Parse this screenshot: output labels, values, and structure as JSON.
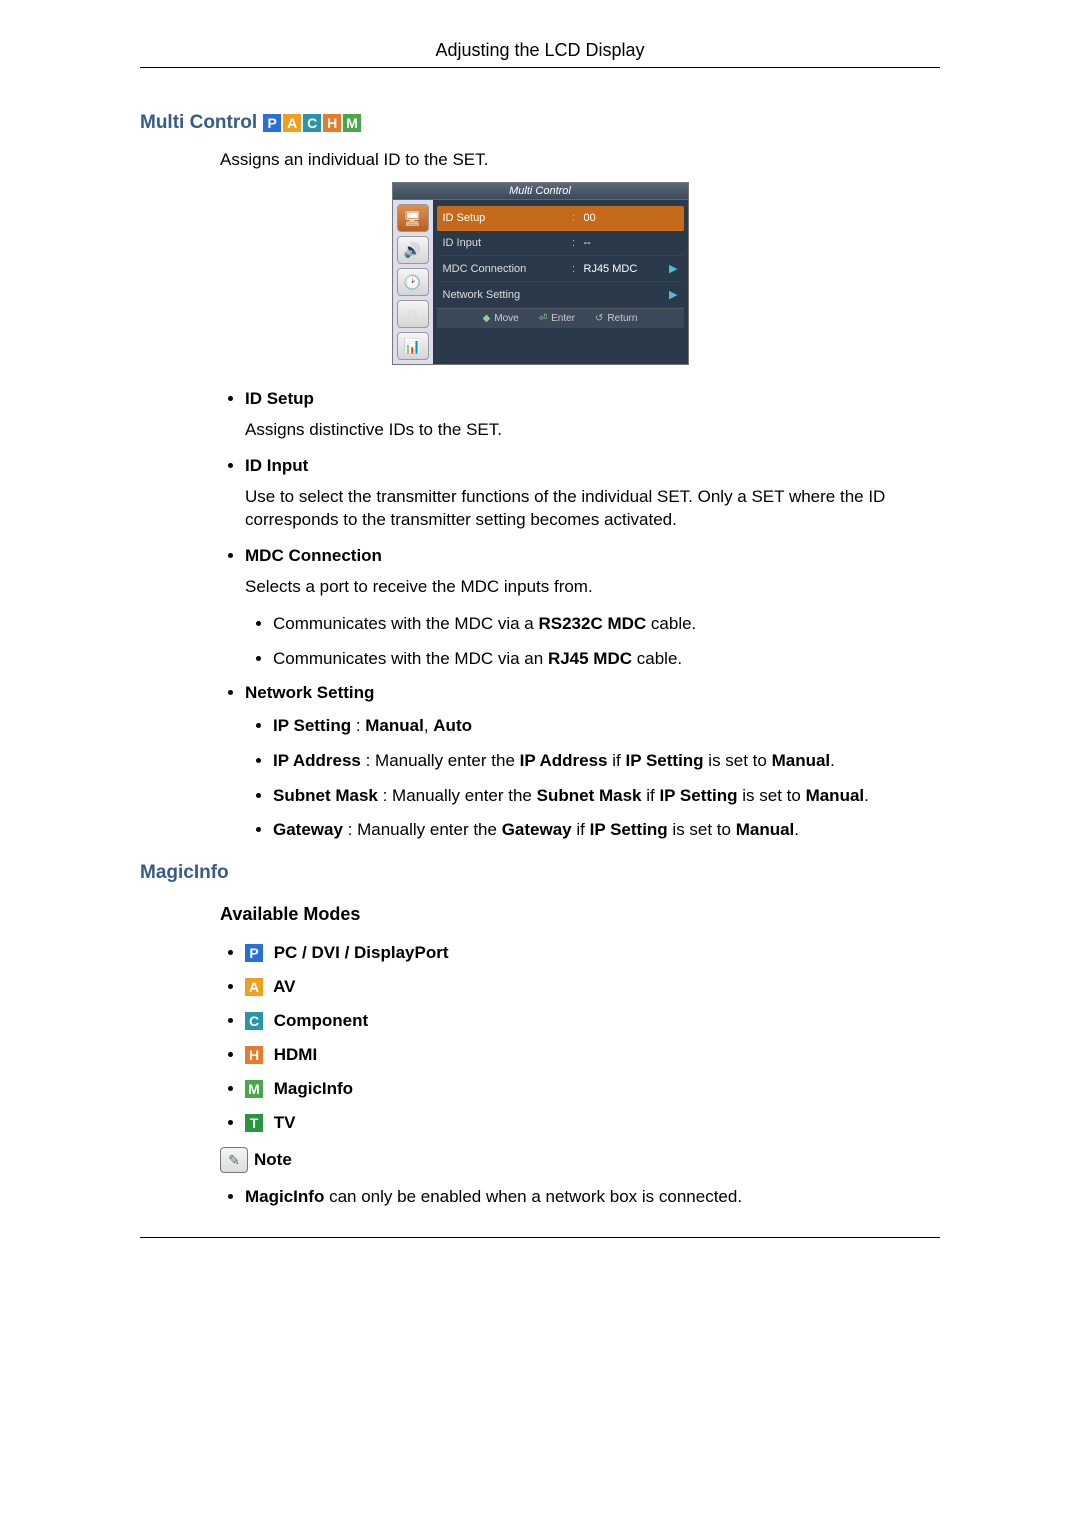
{
  "header": {
    "title": "Adjusting the LCD Display"
  },
  "section1": {
    "title": "Multi Control",
    "badges": [
      "P",
      "A",
      "C",
      "H",
      "M"
    ],
    "intro": "Assigns an individual ID to the SET."
  },
  "osd": {
    "title": "Multi Control",
    "rows": [
      {
        "label": "ID Setup",
        "colon": ":",
        "value": "00",
        "arrow": ""
      },
      {
        "label": "ID Input",
        "colon": ":",
        "value": "--",
        "arrow": ""
      },
      {
        "label": "MDC Connection",
        "colon": ":",
        "value": "RJ45 MDC",
        "arrow": "▶"
      },
      {
        "label": "Network Setting",
        "colon": "",
        "value": "",
        "arrow": "▶"
      }
    ],
    "footer": {
      "move": "Move",
      "enter": "Enter",
      "ret": "Return"
    }
  },
  "items": {
    "idsetup": {
      "title": "ID Setup",
      "desc": "Assigns distinctive IDs to the SET."
    },
    "idinput": {
      "title": "ID Input",
      "desc": "Use to select the transmitter functions of the individual SET. Only a SET where the ID corresponds to the transmitter setting becomes activated."
    },
    "mdc": {
      "title": "MDC Connection",
      "desc": "Selects a port to receive the MDC inputs from.",
      "sub1_a": "Communicates with the MDC via a ",
      "sub1_b": "RS232C MDC",
      "sub1_c": " cable.",
      "sub2_a": "Communicates with the MDC via an ",
      "sub2_b": "RJ45 MDC",
      "sub2_c": " cable."
    },
    "net": {
      "title": "Network Setting",
      "ip_setting": {
        "k": "IP Setting",
        "sep": " : ",
        "v1": "Manual",
        "comma": ", ",
        "v2": "Auto"
      },
      "ip_address": {
        "k": "IP Address",
        "a": " : Manually enter the ",
        "b": "IP Address",
        "c": " if ",
        "d": "IP Setting",
        "e": " is set to ",
        "f": "Manual",
        "g": "."
      },
      "subnet": {
        "k": "Subnet Mask",
        "a": " : Manually enter the ",
        "b": "Subnet Mask",
        "c": " if ",
        "d": "IP Setting",
        "e": " is set to ",
        "f": "Manual",
        "g": "."
      },
      "gateway": {
        "k": "Gateway",
        "a": " : Manually enter the ",
        "b": "Gateway",
        "c": " if ",
        "d": "IP Setting",
        "e": " is set to ",
        "f": "Manual",
        "g": "."
      }
    }
  },
  "section2": {
    "title": "MagicInfo"
  },
  "modes_head": "Available Modes",
  "modes": {
    "p": {
      "letter": "P",
      "label": " PC / DVI / DisplayPort"
    },
    "a": {
      "letter": "A",
      "label": " AV"
    },
    "c": {
      "letter": "C",
      "label": " Component"
    },
    "h": {
      "letter": "H",
      "label": " HDMI"
    },
    "m": {
      "letter": "M",
      "label": " MagicInfo"
    },
    "t": {
      "letter": "T",
      "label": " TV"
    }
  },
  "note": {
    "label": "Note",
    "text_a": "MagicInfo",
    "text_b": " can only be enabled when a network box is connected."
  }
}
